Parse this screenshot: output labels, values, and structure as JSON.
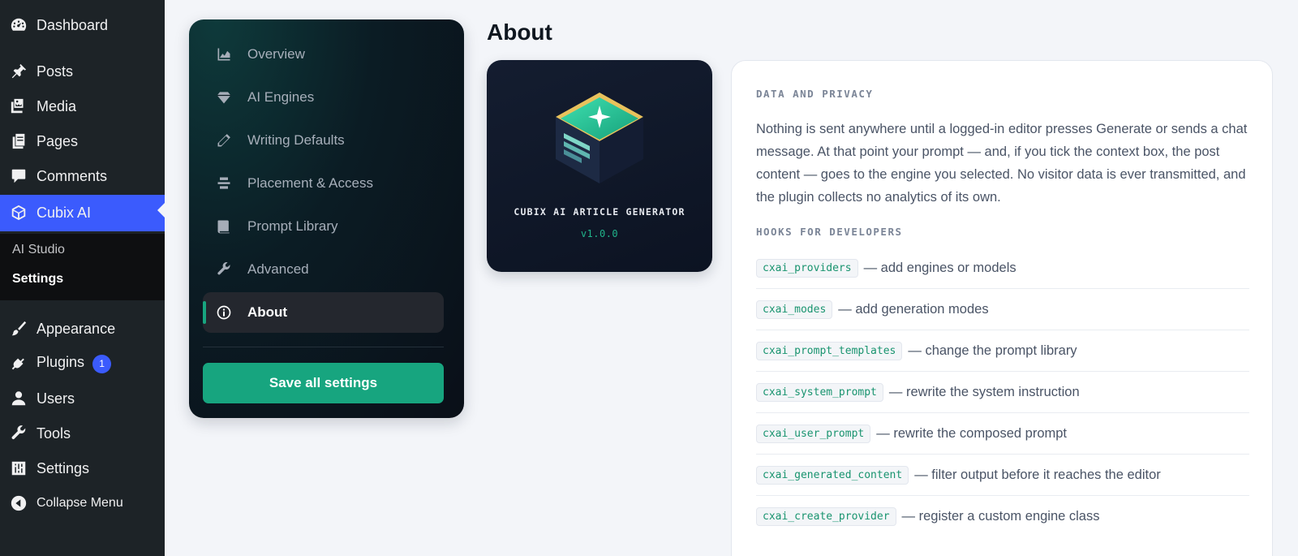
{
  "wp_menu": {
    "dashboard": "Dashboard",
    "posts": "Posts",
    "media": "Media",
    "pages": "Pages",
    "comments": "Comments",
    "cubix_ai": "Cubix AI",
    "submenu": {
      "ai_studio": "AI Studio",
      "settings": "Settings"
    },
    "appearance": "Appearance",
    "plugins": "Plugins",
    "plugins_badge": "1",
    "users": "Users",
    "tools": "Tools",
    "settings": "Settings",
    "collapse": "Collapse Menu",
    "accent_color": "#3b5bfd"
  },
  "settings_nav": {
    "items": [
      {
        "label": "Overview",
        "icon": "chart-area-icon"
      },
      {
        "label": "AI Engines",
        "icon": "diamond-icon"
      },
      {
        "label": "Writing Defaults",
        "icon": "pencil-icon"
      },
      {
        "label": "Placement & Access",
        "icon": "layers-icon"
      },
      {
        "label": "Prompt Library",
        "icon": "book-icon"
      },
      {
        "label": "Advanced",
        "icon": "wrench-icon"
      },
      {
        "label": "About",
        "icon": "info-icon",
        "active": true
      }
    ],
    "save_label": "Save all settings",
    "accent_color": "#17a57f"
  },
  "page": {
    "title": "About"
  },
  "product": {
    "name": "CUBIX AI ARTICLE GENERATOR",
    "version": "v1.0.0"
  },
  "info": {
    "privacy_heading": "DATA AND PRIVACY",
    "privacy_text": "Nothing is sent anywhere until a logged-in editor presses Generate or sends a chat message. At that point your prompt — and, if you tick the context box, the post content — goes to the engine you selected. No visitor data is ever transmitted, and the plugin collects no analytics of its own.",
    "hooks_heading": "HOOKS FOR DEVELOPERS",
    "hooks": [
      {
        "code": "cxai_providers",
        "desc": "— add engines or models"
      },
      {
        "code": "cxai_modes",
        "desc": "— add generation modes"
      },
      {
        "code": "cxai_prompt_templates",
        "desc": "— change the prompt library"
      },
      {
        "code": "cxai_system_prompt",
        "desc": "— rewrite the system instruction"
      },
      {
        "code": "cxai_user_prompt",
        "desc": "— rewrite the composed prompt"
      },
      {
        "code": "cxai_generated_content",
        "desc": "— filter output before it reaches the editor"
      },
      {
        "code": "cxai_create_provider",
        "desc": "— register a custom engine class"
      }
    ]
  }
}
